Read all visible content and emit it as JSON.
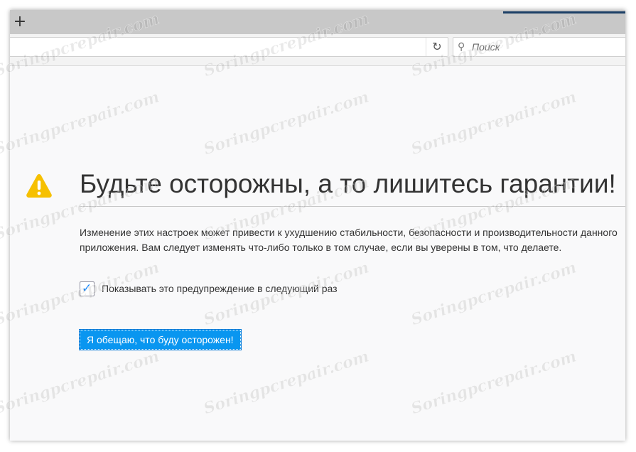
{
  "tabstrip": {
    "new_tab_glyph": "+"
  },
  "navbar": {
    "reload_icon": "reload-icon",
    "reload_glyph": "↻",
    "search": {
      "icon": "search-icon",
      "glyph": "⚲",
      "placeholder": "Поиск"
    }
  },
  "warning": {
    "icon": "warning-icon",
    "icon_color": "#f6c000",
    "title": "Будьте осторожны, а то лишитесь гарантии!",
    "description": "Изменение этих настроек может привести к ухудшению стабильности, безопасности и производительности данного приложения. Вам следует изменять что-либо только в том случае, если вы уверены в том, что делаете.",
    "checkbox": {
      "label": "Показывать это предупреждение в следующий раз",
      "checked": true,
      "mark": "✓"
    },
    "button_label": "Я обещаю, что буду осторожен!",
    "button_color": "#0996f0"
  },
  "watermark": {
    "text": "Soringpcrepair.com"
  }
}
